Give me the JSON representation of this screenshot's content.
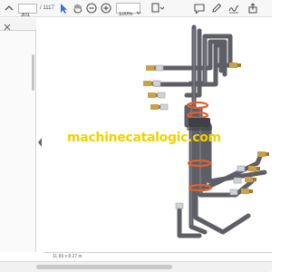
{
  "toolbar": {
    "current_page": "301",
    "total_pages": "/ 1117",
    "zoom_value": "100%",
    "icons": [
      "select-arrow-icon",
      "hand-pan-icon",
      "zoom-out-icon",
      "zoom-in-icon",
      "fit-page-icon",
      "comment-icon",
      "pencil-icon",
      "sign-icon",
      "share-icon"
    ]
  },
  "document": {
    "watermark": "machinecatalogic.com",
    "page_size": "11.69 x 8.27 in"
  },
  "colors": {
    "toolbar_bg": "#f7f7f7",
    "icon": "#555555",
    "watermark": "#f4d000",
    "hose": "#5e5e66",
    "fitting_brass": "#c9a14a",
    "fitting_silver": "#cfd2d6",
    "clamp_orange": "#e0622b"
  }
}
